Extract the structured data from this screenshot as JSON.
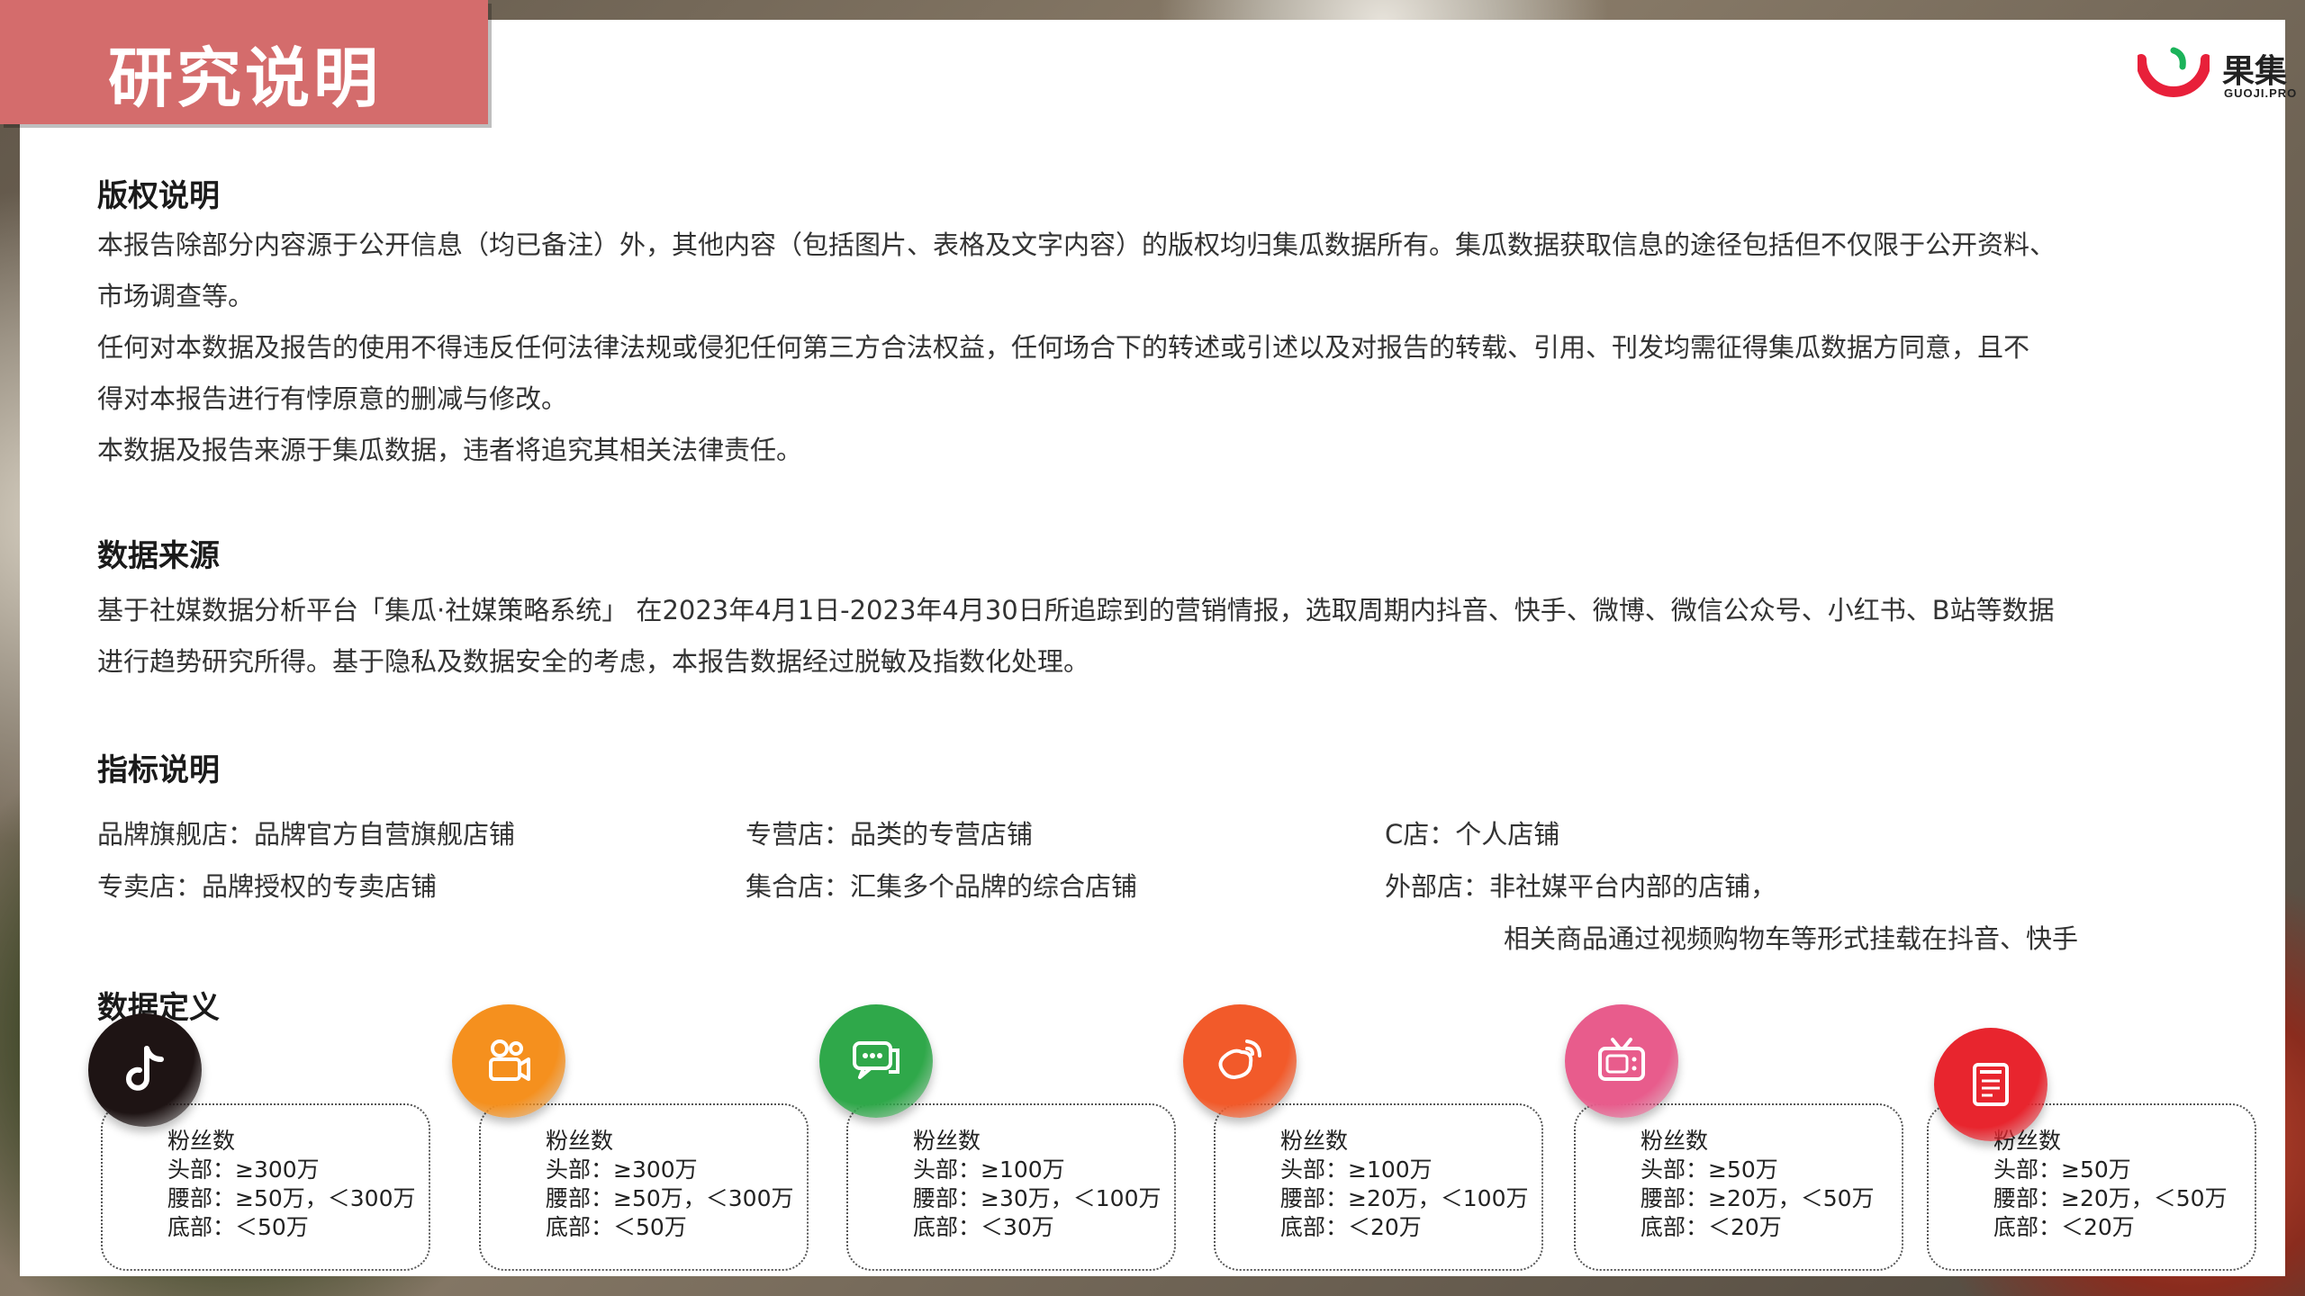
{
  "title": "研究说明",
  "logo": {
    "name_cn": "果集",
    "name_en": "GUOJI.PRO",
    "accent": "#e8203a",
    "accent2": "#1bb35a"
  },
  "copyright": {
    "heading": "版权说明",
    "lines": [
      "本报告除部分内容源于公开信息（均已备注）外，其他内容（包括图片、表格及文字内容）的版权均归集瓜数据所有。集瓜数据获取信息的途径包括但不仅限于公开资料、",
      "市场调查等。",
      "任何对本数据及报告的使用不得违反任何法律法规或侵犯任何第三方合法权益，任何场合下的转述或引述以及对报告的转载、引用、刊发均需征得集瓜数据方同意，且不",
      "得对本报告进行有悖原意的删减与修改。",
      "本数据及报告来源于集瓜数据，违者将追究其相关法律责任。"
    ]
  },
  "source": {
    "heading": "数据来源",
    "lines": [
      "基于社媒数据分析平台「集瓜·社媒策略系统」 在2023年4月1日-2023年4月30日所追踪到的营销情报，选取周期内抖音、快手、微博、微信公众号、小红书、B站等数据",
      "进行趋势研究所得。基于隐私及数据安全的考虑，本报告数据经过脱敏及指数化处理。"
    ]
  },
  "indicators": {
    "heading": "指标说明",
    "items": [
      "品牌旗舰店：品牌官方自营旗舰店铺",
      "专营店：品类的专营店铺",
      "C店：个人店铺",
      "专卖店：品牌授权的专卖店铺",
      "集合店：汇集多个品牌的综合店铺",
      "外部店：非社媒平台内部的店铺，",
      "相关商品通过视频购物车等形式挂载在抖音、快手"
    ]
  },
  "definitions": {
    "heading": "数据定义",
    "platforms": [
      {
        "icon": "douyin-icon",
        "color": "#1e1414",
        "lines": [
          "粉丝数",
          "头部：≥300万",
          "腰部：≥50万，＜300万",
          "底部：＜50万"
        ]
      },
      {
        "icon": "kuaishou-icon",
        "color": "#f5901e",
        "lines": [
          "粉丝数",
          "头部：≥300万",
          "腰部：≥50万，＜300万",
          "底部：＜50万"
        ]
      },
      {
        "icon": "wechat-icon",
        "color": "#2fa84a",
        "lines": [
          "粉丝数",
          "头部：≥100万",
          "腰部：≥30万，＜100万",
          "底部：＜30万"
        ]
      },
      {
        "icon": "weibo-icon",
        "color": "#f25a2a",
        "lines": [
          "粉丝数",
          "头部：≥100万",
          "腰部：≥20万，＜100万",
          "底部：＜20万"
        ]
      },
      {
        "icon": "bilibili-icon",
        "color": "#e85c8c",
        "lines": [
          "粉丝数",
          "头部：≥50万",
          "腰部：≥20万，＜50万",
          "底部：＜20万"
        ]
      },
      {
        "icon": "xiaohongshu-icon",
        "color": "#e8252e",
        "lines": [
          "粉丝数",
          "头部：≥50万",
          "腰部：≥20万，＜50万",
          "底部：＜20万"
        ]
      }
    ]
  }
}
